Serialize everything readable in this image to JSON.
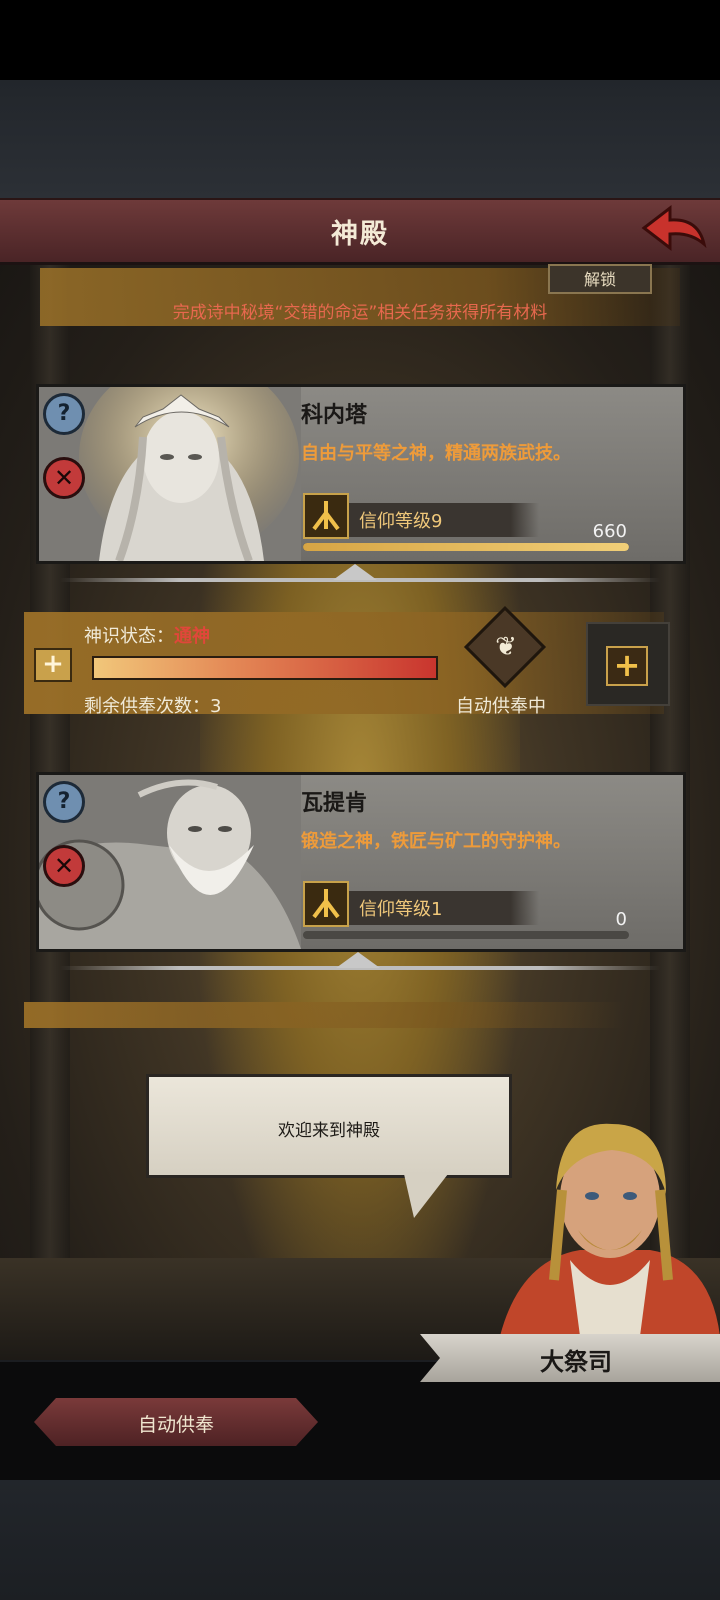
{
  "header": {
    "title": "神殿"
  },
  "quest": {
    "unlock_label": "解锁",
    "description": "完成诗中秘境“交错的命运”相关任务获得所有材料"
  },
  "gods": [
    {
      "name": "科内塔",
      "description": "自由与平等之神，精通两族武技。",
      "faith_label": "信仰等级9",
      "points": "660",
      "progress": 1.0,
      "help_icon": "question-icon",
      "close_icon": "close-icon"
    },
    {
      "name": "瓦提肯",
      "description": "锻造之神，铁匠与矿工的守护神。",
      "faith_label": "信仰等级1",
      "points": "0",
      "progress": 0.0,
      "help_icon": "question-icon",
      "close_icon": "close-icon"
    }
  ],
  "status": {
    "label": "神识状态：",
    "value": "通神",
    "bar_fill": 1.0,
    "remaining": "剩余供奉次数：3",
    "auto_label": "自动供奉中"
  },
  "dialog": {
    "text": "欢迎来到神殿",
    "speaker": "大祭司"
  },
  "footer": {
    "auto_button": "自动供奉"
  },
  "colors": {
    "header": "#5e2f31",
    "accent_gold": "#c9a14b",
    "quest_red": "#e7684e",
    "desc_orange": "#ee9b3a",
    "status_red": "#e0473a"
  }
}
